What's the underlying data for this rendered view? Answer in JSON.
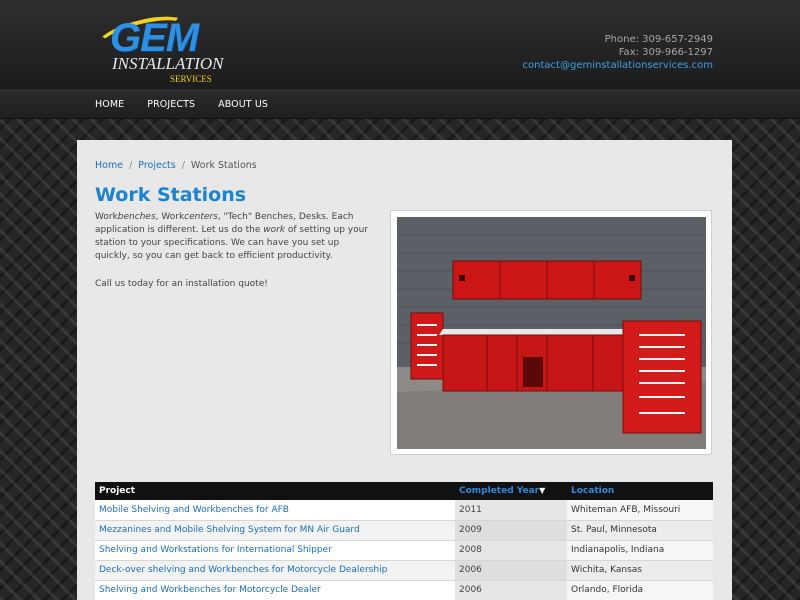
{
  "brand": {
    "name": "GEM",
    "line2": "INSTALLATION",
    "line3": "SERVICES"
  },
  "contact": {
    "phone": "Phone: 309-657-2949",
    "fax": "Fax: 309-966-1297",
    "email": "contact@geminstallationservices.com"
  },
  "nav": {
    "items": [
      {
        "label": "HOME"
      },
      {
        "label": "PROJECTS"
      },
      {
        "label": "ABOUT US"
      }
    ]
  },
  "breadcrumb": {
    "home": "Home",
    "projects": "Projects",
    "current": "Work Stations"
  },
  "page": {
    "title": "Work Stations",
    "intro": {
      "p1_a": "Work",
      "p1_b": "benches",
      "p1_c": ", Work",
      "p1_d": "centers",
      "p1_e": ", \"Tech\" Benches, Desks.  Each application is different.  Let us do the ",
      "p1_f": "work",
      "p1_g": " of setting up your station to your specifications.  We can have you set up quickly, so you can get back to efficient productivity."
    },
    "cta": "Call us today for an installation quote!"
  },
  "table": {
    "headers": {
      "project": "Project",
      "year": "Completed Year",
      "sort_indicator": "▼",
      "location": "Location"
    },
    "rows": [
      {
        "project": "Mobile Shelving and Workbenches for AFB",
        "year": "2011",
        "location": "Whiteman AFB, Missouri"
      },
      {
        "project": "Mezzanines and Mobile Shelving System for MN Air Guard",
        "year": "2009",
        "location": "St. Paul, Minnesota"
      },
      {
        "project": "Shelving and Workstations for International Shipper",
        "year": "2008",
        "location": "Indianapolis, Indiana"
      },
      {
        "project": "Deck-over shelving and Workbenches for Motorcycle Dealership",
        "year": "2006",
        "location": "Wichita, Kansas"
      },
      {
        "project": "Shelving and Workbenches for Motorcycle Dealer",
        "year": "2006",
        "location": "Orlando, Florida"
      }
    ]
  },
  "colors": {
    "accent": "#1a83d2",
    "link": "#1a6fc0",
    "logo_yellow": "#f2d21b",
    "cabinet_red": "#d11a1a"
  }
}
